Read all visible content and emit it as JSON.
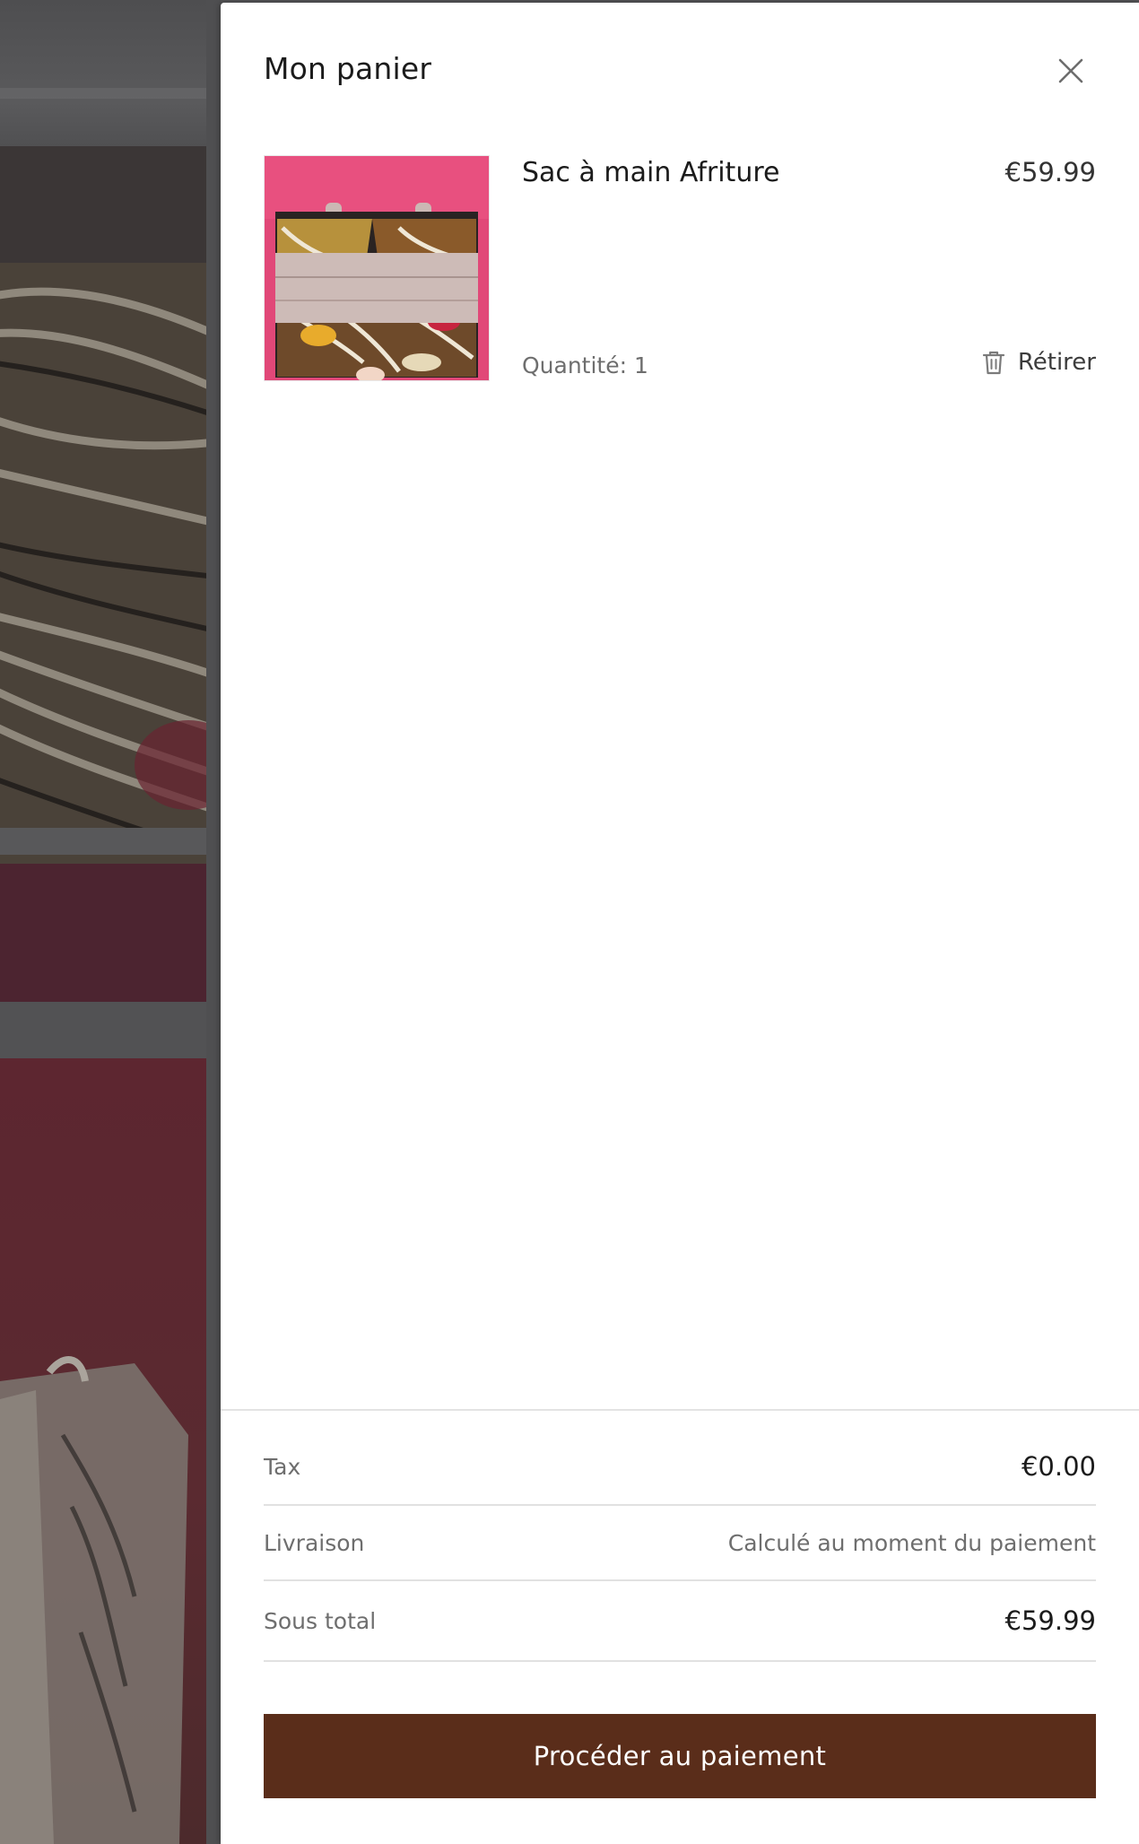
{
  "cart": {
    "title": "Mon panier",
    "close_icon": "close-icon",
    "items": [
      {
        "name": "Sac à main Afriture",
        "price": "€59.99",
        "quantity_text": "Quantité: 1",
        "remove_label": "Rétirer",
        "remove_icon": "trash-icon"
      }
    ]
  },
  "summary": {
    "tax_label": "Tax",
    "tax_value": "€0.00",
    "shipping_label": "Livraison",
    "shipping_value": "Calculé au moment du paiement",
    "subtotal_label": "Sous total",
    "subtotal_value": "€59.99"
  },
  "checkout": {
    "label": "Procéder au paiement"
  },
  "colors": {
    "checkout_button": "#5a2d1a",
    "overlay": "#525254",
    "drawer_background": "#ffffff"
  }
}
